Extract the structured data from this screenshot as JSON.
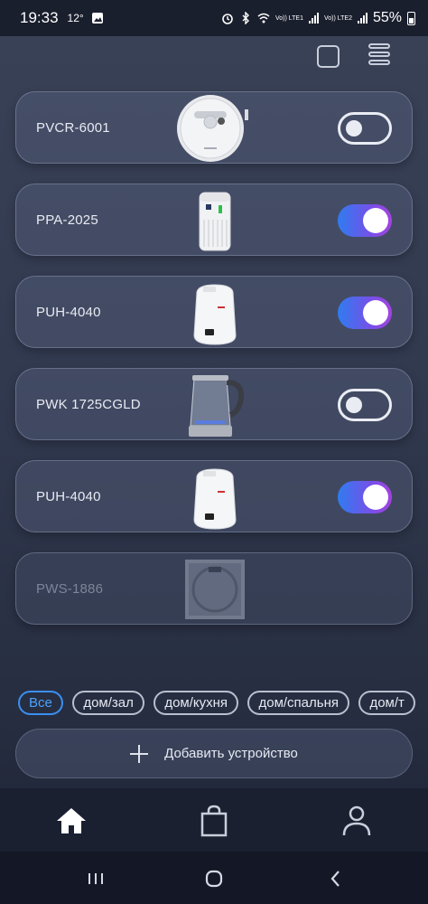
{
  "status_bar": {
    "time": "19:33",
    "temperature": "12°",
    "battery": "55%",
    "sim1": "Vo)) LTE1",
    "sim2": "Vo)) LTE2"
  },
  "devices": [
    {
      "name": "PVCR-6001",
      "state": "off",
      "image": "robot-vacuum"
    },
    {
      "name": "PPA-2025",
      "state": "on",
      "image": "air-purifier"
    },
    {
      "name": "PUH-4040",
      "state": "on",
      "image": "humidifier"
    },
    {
      "name": "PWK 1725CGLD",
      "state": "off",
      "image": "glass-kettle"
    },
    {
      "name": "PUH-4040",
      "state": "on",
      "image": "humidifier"
    },
    {
      "name": "PWS-1886",
      "state": "offline",
      "image": "bathroom-scale"
    }
  ],
  "tags": [
    "Все",
    "дом/зал",
    "дом/кухня",
    "дом/спальня",
    "дом/т"
  ],
  "active_tag": "Все",
  "add_device_label": "Добавить устройство",
  "bottom_nav": [
    "home-icon",
    "shopping-bag-icon",
    "profile-icon"
  ],
  "colors": {
    "accent": "#3b8ff2",
    "toggle_gradient_start": "#2f7cf0",
    "toggle_gradient_end": "#a443e0"
  }
}
